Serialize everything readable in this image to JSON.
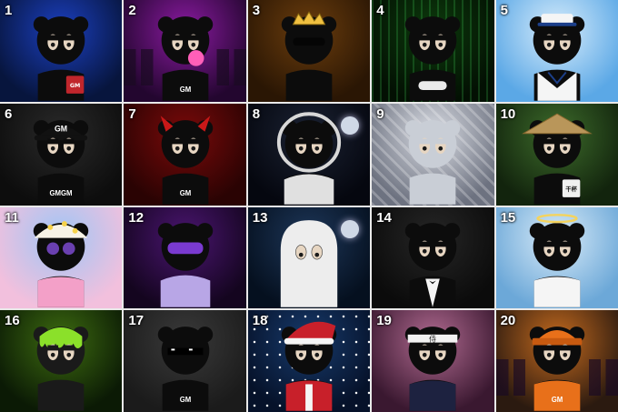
{
  "gallery": {
    "cells": [
      {
        "num": "1",
        "theme": "lightning-storm",
        "bg": [
          "#07153d",
          "#1b3fbf"
        ],
        "accent": "#7fb7ff",
        "prop": "mug",
        "mug_text": "GM",
        "mug_color": "#c0262c"
      },
      {
        "num": "2",
        "theme": "neon-city-bubblegum",
        "bg": [
          "#23062f",
          "#8a1aa0"
        ],
        "accent": "#ff4fb0",
        "prop": "bubble",
        "shirt_text": "GM"
      },
      {
        "num": "3",
        "theme": "king-crown",
        "bg": [
          "#2a1604",
          "#6b3d0d"
        ],
        "accent": "#f0c040",
        "prop": "crown"
      },
      {
        "num": "4",
        "theme": "matrix-gamer",
        "bg": [
          "#031003",
          "#0c3a0c"
        ],
        "accent": "#3fd05a",
        "prop": "controller"
      },
      {
        "num": "5",
        "theme": "sailor-pipe",
        "bg": [
          "#5ba8e6",
          "#d7ecfb"
        ],
        "accent": "#ffffff",
        "prop": "sailor"
      },
      {
        "num": "6",
        "theme": "gm-cap-chain",
        "bg": [
          "#0d0d0d",
          "#2a2a2a"
        ],
        "accent": "#f5f5f5",
        "prop": "cap",
        "cap_text": "GM",
        "shirt_text": "GMGM"
      },
      {
        "num": "7",
        "theme": "devil",
        "bg": [
          "#2a0303",
          "#7a0a0a"
        ],
        "accent": "#e02020",
        "prop": "horns",
        "shirt_text": "GM"
      },
      {
        "num": "8",
        "theme": "astronaut-moon",
        "bg": [
          "#05070f",
          "#1b2233"
        ],
        "accent": "#d8d8d8",
        "prop": "astronaut"
      },
      {
        "num": "9",
        "theme": "diamond",
        "bg": [
          "#6d7280",
          "#d9dce3"
        ],
        "accent": "#e8ecf3",
        "prop": "diamond"
      },
      {
        "num": "10",
        "theme": "bamboo-straw-hat",
        "bg": [
          "#12240d",
          "#3d6b2b"
        ],
        "accent": "#c9a15e",
        "prop": "strawhat",
        "mug_text": "干杯",
        "mug_color": "#f0f0f0"
      },
      {
        "num": "11",
        "theme": "flower-bucket-hat",
        "bg": [
          "#f2c0dd",
          "#9fc6f5"
        ],
        "accent": "#f6d24a",
        "prop": "bucket"
      },
      {
        "num": "12",
        "theme": "puffer-goggles",
        "bg": [
          "#14051f",
          "#4a1570"
        ],
        "accent": "#a35cff",
        "prop": "goggles"
      },
      {
        "num": "13",
        "theme": "ghost-moon",
        "bg": [
          "#05101f",
          "#1d3658"
        ],
        "accent": "#f2f2f2",
        "prop": "ghost"
      },
      {
        "num": "14",
        "theme": "tuxedo-wine",
        "bg": [
          "#0b0b0b",
          "#262626"
        ],
        "accent": "#7a1020",
        "prop": "tux"
      },
      {
        "num": "15",
        "theme": "angel-halo",
        "bg": [
          "#6ca8d8",
          "#d9ebf8"
        ],
        "accent": "#f4d35e",
        "prop": "angel"
      },
      {
        "num": "16",
        "theme": "toxic-slime",
        "bg": [
          "#0b1a05",
          "#3d6b10"
        ],
        "accent": "#8be02a",
        "prop": "toxic"
      },
      {
        "num": "17",
        "theme": "thug-life-graffiti",
        "bg": [
          "#1b1b1b",
          "#3a3a3a"
        ],
        "accent": "#e6b830",
        "prop": "pixelglasses",
        "shirt_text": "GM"
      },
      {
        "num": "18",
        "theme": "santa-snow",
        "bg": [
          "#06122a",
          "#173a6b"
        ],
        "accent": "#d0202a",
        "prop": "santa"
      },
      {
        "num": "19",
        "theme": "samurai-sakura",
        "bg": [
          "#3a1830",
          "#b06a90"
        ],
        "accent": "#f5b5d0",
        "prop": "samurai",
        "band_text": "侍"
      },
      {
        "num": "20",
        "theme": "sunset-city-beanie",
        "bg": [
          "#2b1a10",
          "#c46a1e"
        ],
        "accent": "#e8701a",
        "prop": "beanie",
        "shirt_text": "GM"
      }
    ]
  }
}
